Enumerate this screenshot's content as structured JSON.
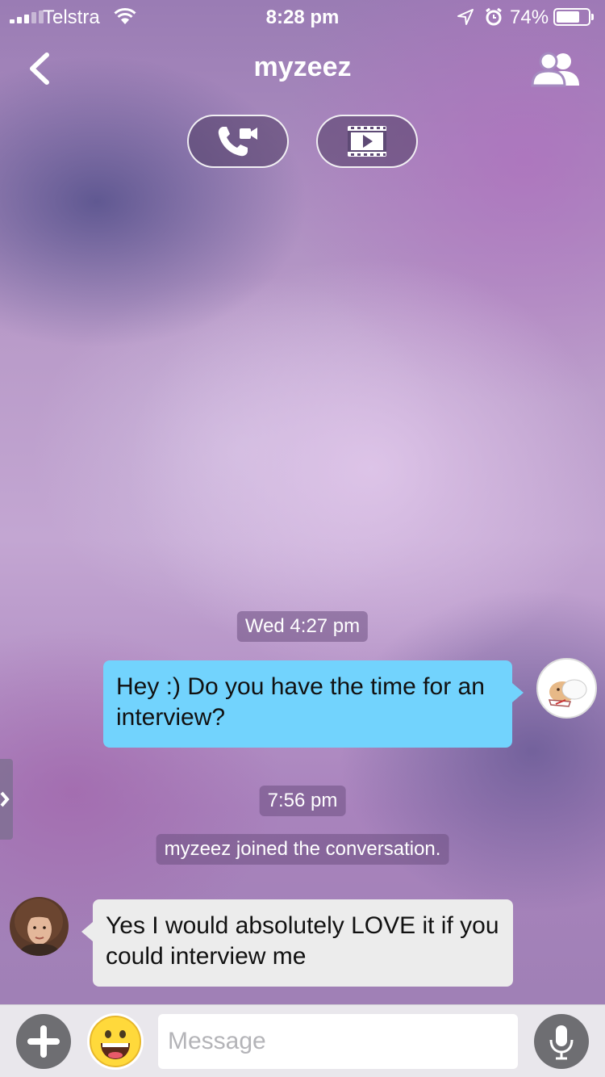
{
  "status_bar": {
    "carrier": "Telstra",
    "time": "8:28 pm",
    "battery_percent": "74%",
    "battery_level": 0.74,
    "icons": [
      "signal-icon",
      "wifi-icon",
      "location-arrow-icon",
      "alarm-icon",
      "battery-icon"
    ]
  },
  "nav": {
    "title": "myzeez",
    "back_icon": "chevron-left-icon",
    "members_icon": "people-icon",
    "call_icon": "phone-video-icon",
    "media_icon": "film-play-icon"
  },
  "conversation": {
    "timestamp_1": "Wed 4:27 pm",
    "outgoing_message": "Hey :) Do you have the time for an interview?",
    "timestamp_2": "7:56 pm",
    "system_message": "myzeez joined the conversation.",
    "incoming_message": "Yes I would absolutely LOVE it if you could interview me"
  },
  "input_bar": {
    "placeholder": "Message",
    "value": "",
    "icons": [
      "plus-icon",
      "emoji-icon",
      "microphone-icon"
    ]
  },
  "colors": {
    "outgoing_bubble": "#72d3fd",
    "incoming_bubble": "#ececec",
    "button_gray": "#6e6e72",
    "emoji_yellow": "#ffd93b"
  }
}
